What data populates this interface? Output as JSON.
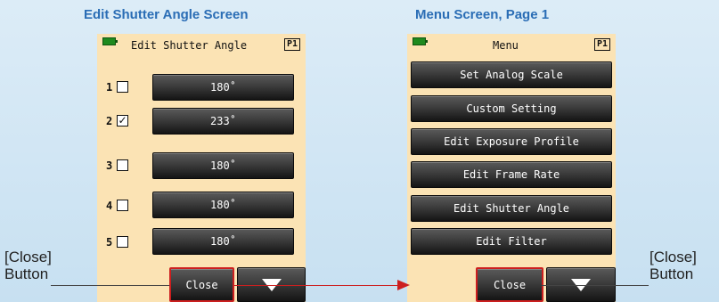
{
  "left_panel": {
    "caption": "Edit Shutter Angle Screen",
    "header": {
      "title": "Edit Shutter Angle",
      "page": "P1"
    },
    "rows": [
      {
        "num": "1",
        "checked": false,
        "value": "180˚"
      },
      {
        "num": "2",
        "checked": true,
        "value": "233˚"
      },
      {
        "num": "3",
        "checked": false,
        "value": "180˚"
      },
      {
        "num": "4",
        "checked": false,
        "value": "180˚"
      },
      {
        "num": "5",
        "checked": false,
        "value": "180˚"
      }
    ],
    "close_label": "Close"
  },
  "right_panel": {
    "caption": "Menu Screen, Page 1",
    "header": {
      "title": "Menu",
      "page": "P1"
    },
    "items": [
      "Set Analog Scale",
      "Custom Setting",
      "Edit Exposure Profile",
      "Edit Frame Rate",
      "Edit Shutter Angle",
      "Edit Filter"
    ],
    "close_label": "Close"
  },
  "callouts": {
    "left": {
      "line1": "[Close]",
      "line2": "Button"
    },
    "right": {
      "line1": "[Close]",
      "line2": "Button"
    }
  },
  "colors": {
    "caption": "#2a6db5",
    "highlight": "#cc1f1f",
    "screen_bg": "#fbe3b4"
  }
}
